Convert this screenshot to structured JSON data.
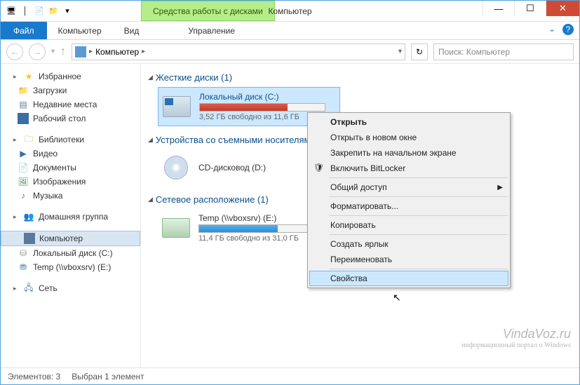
{
  "title": "Компьютер",
  "context_tab": "Средства работы с дисками",
  "ribbon": {
    "file": "Файл",
    "tabs": [
      "Компьютер",
      "Вид",
      "Управление"
    ]
  },
  "nav": {
    "breadcrumb": "Компьютер",
    "search_placeholder": "Поиск: Компьютер"
  },
  "sidebar": {
    "favorites": {
      "label": "Избранное",
      "items": [
        "Загрузки",
        "Недавние места",
        "Рабочий стол"
      ]
    },
    "libraries": {
      "label": "Библиотеки",
      "items": [
        "Видео",
        "Документы",
        "Изображения",
        "Музыка"
      ]
    },
    "homegroup": "Домашняя группа",
    "computer": {
      "label": "Компьютер",
      "items": [
        "Локальный диск (C:)",
        "Temp (\\\\vboxsrv) (E:)"
      ]
    },
    "network": "Сеть"
  },
  "sections": {
    "hdd": {
      "header": "Жесткие диски (1)",
      "drive": {
        "name": "Локальный диск (C:)",
        "free": "3,52 ГБ свободно из 11,6 ГБ",
        "fill_pct": 70
      }
    },
    "removable": {
      "header": "Устройства со съемными носителями",
      "drive": {
        "name": "CD-дисковод (D:)"
      }
    },
    "network": {
      "header": "Сетевое расположение (1)",
      "drive": {
        "name": "Temp (\\\\vboxsrv) (E:)",
        "free": "11,4 ГБ свободно из 31,0 ГБ",
        "fill_pct": 63
      }
    }
  },
  "context_menu": {
    "open": "Открыть",
    "open_new": "Открыть в новом окне",
    "pin": "Закрепить на начальном экране",
    "bitlocker": "Включить BitLocker",
    "share": "Общий доступ",
    "format": "Форматировать...",
    "copy": "Копировать",
    "shortcut": "Создать ярлык",
    "rename": "Переименовать",
    "properties": "Свойства"
  },
  "statusbar": {
    "count": "Элементов: 3",
    "selected": "Выбран 1 элемент"
  },
  "watermark": {
    "site": "VindaVoz.ru",
    "tagline": "информационный портал о Windows"
  }
}
